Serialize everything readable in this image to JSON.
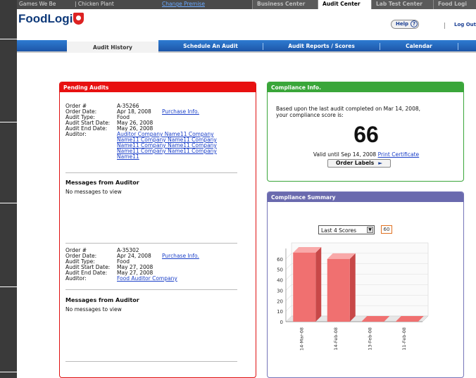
{
  "topbar": {
    "site": "Games We Be",
    "plant": "| Chicken Plant",
    "change_premise": "Change Premise",
    "tabs": [
      "Business Center",
      "Audit Center",
      "Lab Test Center",
      "Food Logi"
    ],
    "active_tab": "Audit Center"
  },
  "header": {
    "logo": "FoodLogi",
    "help": "Help",
    "help_q": "?",
    "logout": "Log Out"
  },
  "nav": {
    "items": [
      "Audit History",
      "Schedule An Audit",
      "Audit Reports / Scores",
      "Calendar"
    ],
    "active": "Audit History"
  },
  "pending": {
    "title": "Pending Audits",
    "labels": {
      "order": "Order #",
      "date": "Order Date:",
      "type": "Audit Type:",
      "start": "Audit Start Date:",
      "end": "Audit End Date:",
      "auditor": "Auditor:"
    },
    "purchase_info": "Purchase Info.",
    "orders": [
      {
        "order": "A-35266",
        "date": "Apr 18, 2008",
        "type": "Food",
        "start": "May 26, 2008",
        "end": "May 26, 2008",
        "auditor_lines": [
          "Auditor Company Name11 Company",
          "Name11 Company Name11 Company",
          "Name11 Company Name11 Company",
          "Name11 Company Name11 Company",
          "Name11"
        ]
      },
      {
        "order": "A-35302",
        "date": "Apr 24, 2008",
        "type": "Food",
        "start": "May 27, 2008",
        "end": "May 27, 2008",
        "auditor_lines": [
          "Food Auditor Company"
        ]
      }
    ],
    "messages_title": "Messages from Auditor",
    "messages_empty": "No messages to view"
  },
  "compliance_info": {
    "title": "Compliance Info.",
    "text_line1": "Based upon the last audit completed on Mar 14, 2008,",
    "text_line2": "your compliance score is:",
    "score": "66",
    "valid_until": "Valid until Sep 14, 2008",
    "print_cert": "Print Certificate",
    "order_labels": "Order Labels",
    "order_arrow": "►"
  },
  "compliance_summary": {
    "title": "Compliance Summary",
    "select_value": "Last 4 Scores",
    "select_arrow": "▼",
    "badge": "60"
  },
  "colors": {
    "bar": "#f07070",
    "bar_side": "#c84848",
    "bar_top": "#f9a9a9"
  },
  "chart_data": {
    "type": "bar",
    "categories": [
      "14-Mar-08",
      "14-Feb-08",
      "13-Feb-08",
      "11-Feb-08"
    ],
    "values": [
      66,
      60,
      0,
      0
    ],
    "ylim": [
      0,
      70
    ],
    "yticks": [
      0,
      10,
      20,
      30,
      40,
      50,
      60
    ],
    "grid": true
  }
}
